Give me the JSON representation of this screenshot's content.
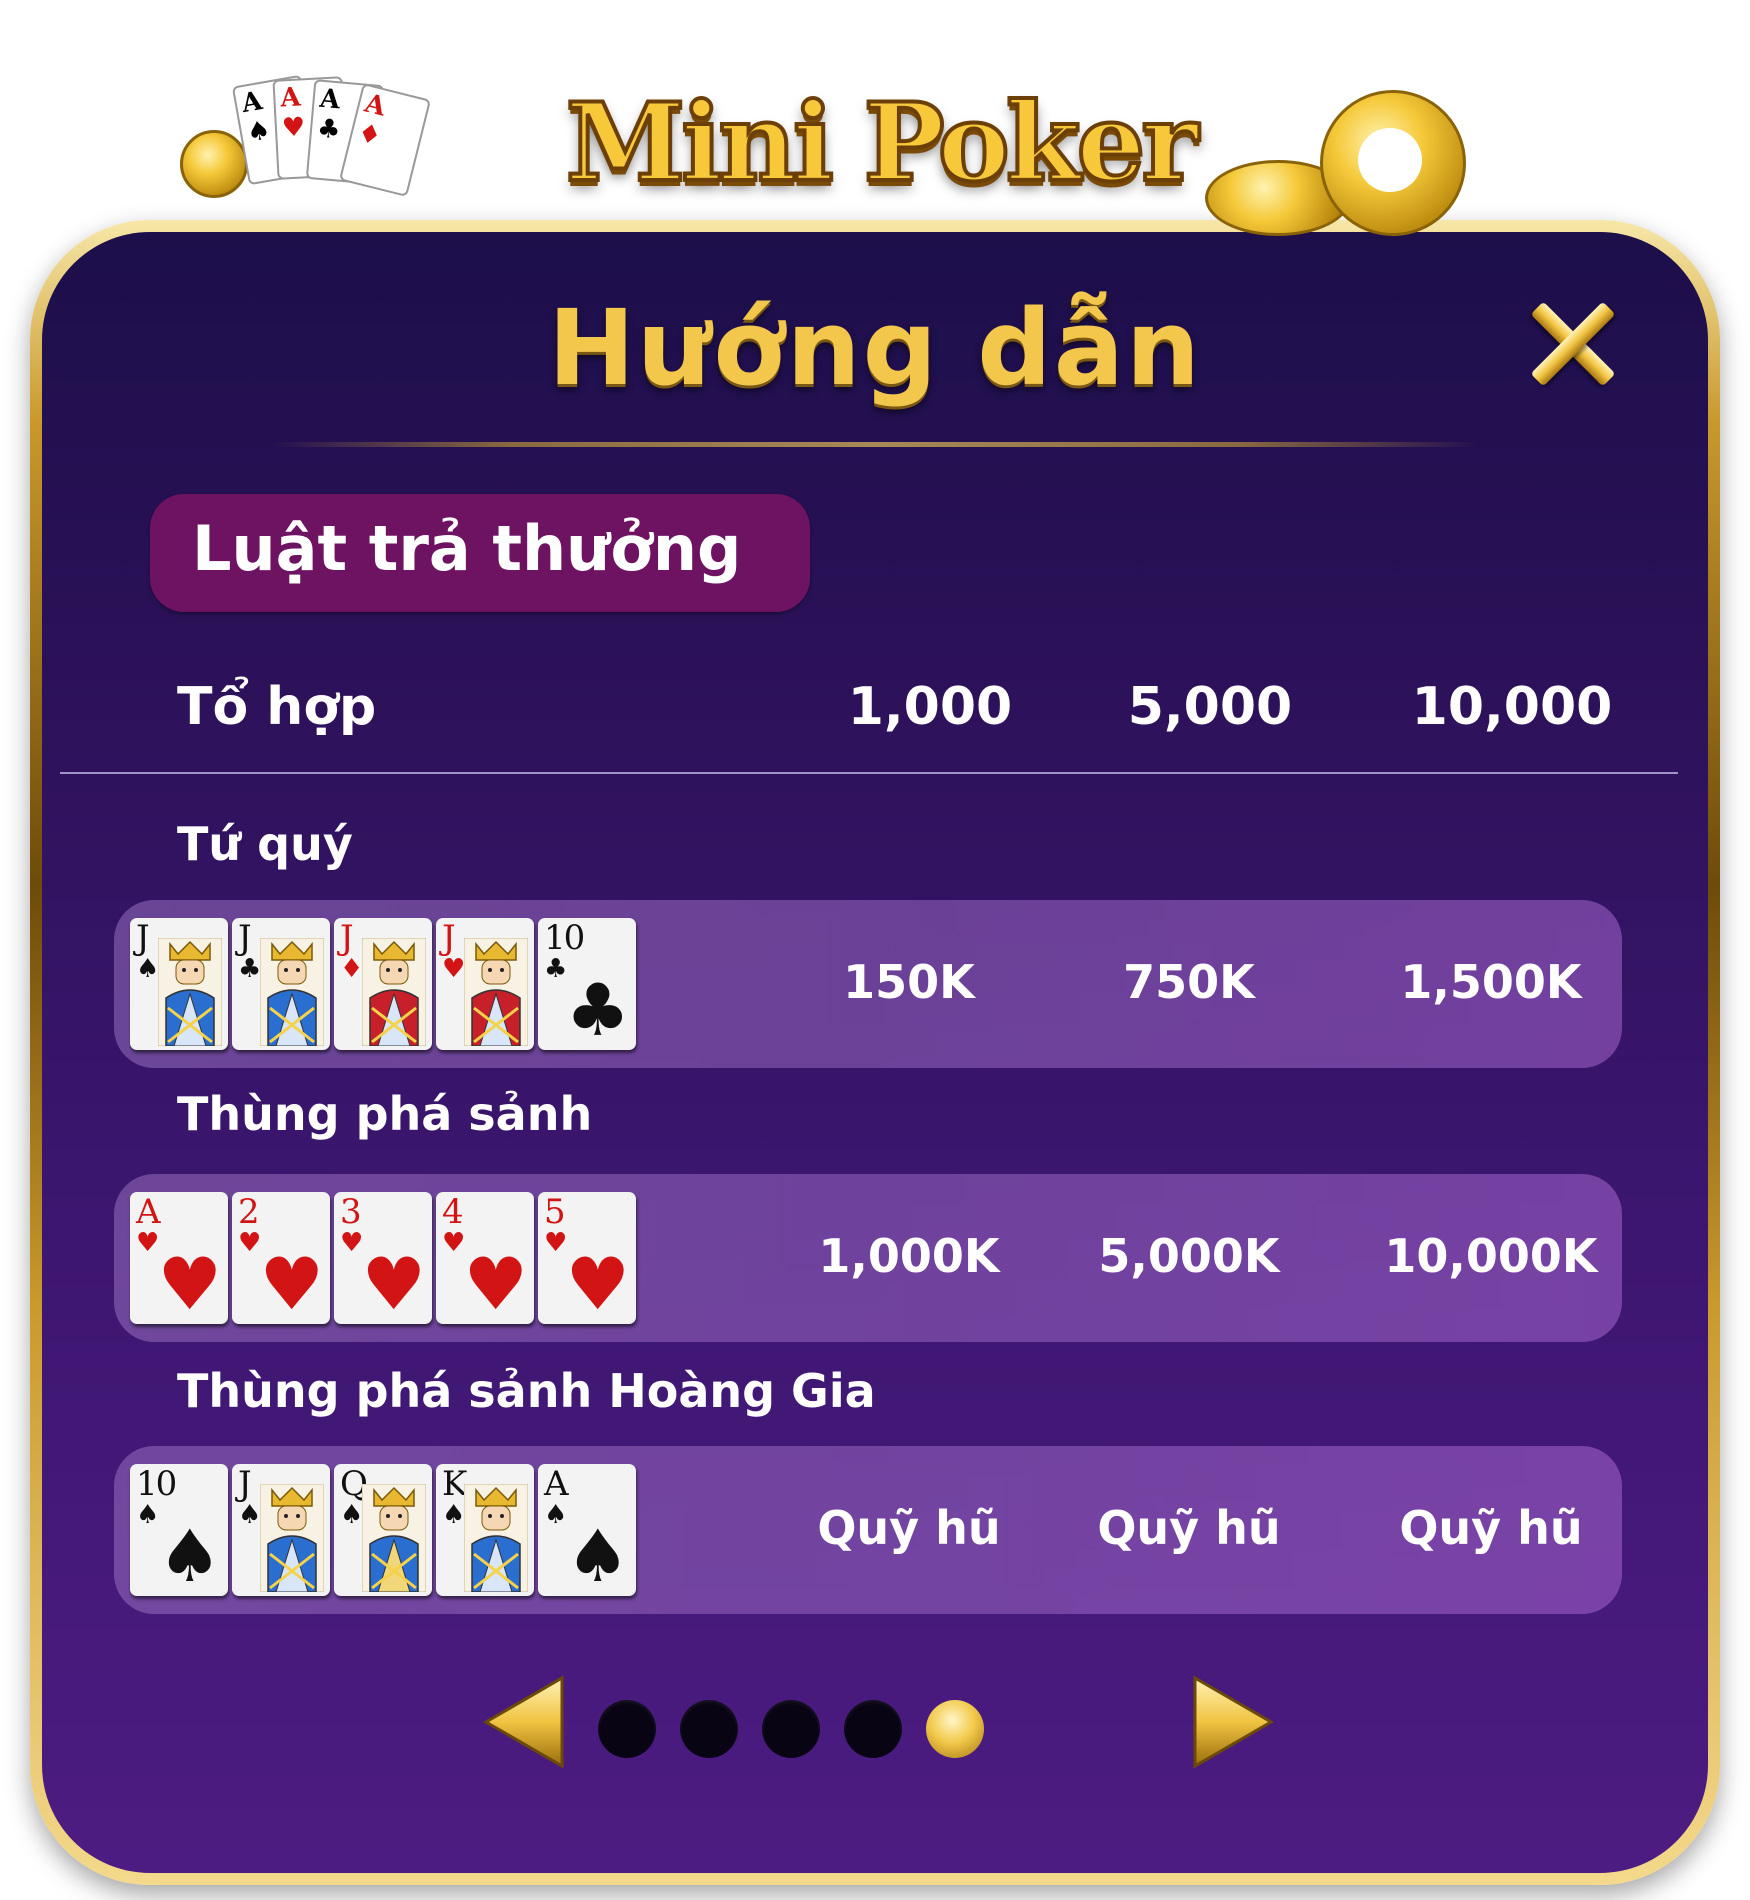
{
  "logo": {
    "text": "Mini Poker",
    "card_rank": "A"
  },
  "dialog": {
    "title": "Hướng dẫn",
    "section_label": "Luật trả thưởng"
  },
  "table": {
    "headers": {
      "combo": "Tổ hợp",
      "bets": [
        "1,000",
        "5,000",
        "10,000"
      ]
    },
    "rows": [
      {
        "name": "Tứ quý",
        "cards": [
          {
            "rank": "J",
            "suit": "♠",
            "color": "black",
            "face": "jack"
          },
          {
            "rank": "J",
            "suit": "♣",
            "color": "black",
            "face": "jack"
          },
          {
            "rank": "J",
            "suit": "♦",
            "color": "red",
            "face": "jack"
          },
          {
            "rank": "J",
            "suit": "♥",
            "color": "red",
            "face": "jack"
          },
          {
            "rank": "10",
            "suit": "♣",
            "color": "black",
            "face": ""
          }
        ],
        "payouts": [
          "150K",
          "750K",
          "1,500K"
        ]
      },
      {
        "name": "Thùng phá sảnh",
        "cards": [
          {
            "rank": "A",
            "suit": "♥",
            "color": "red",
            "face": ""
          },
          {
            "rank": "2",
            "suit": "♥",
            "color": "red",
            "face": ""
          },
          {
            "rank": "3",
            "suit": "♥",
            "color": "red",
            "face": ""
          },
          {
            "rank": "4",
            "suit": "♥",
            "color": "red",
            "face": ""
          },
          {
            "rank": "5",
            "suit": "♥",
            "color": "red",
            "face": ""
          }
        ],
        "payouts": [
          "1,000K",
          "5,000K",
          "10,000K"
        ]
      },
      {
        "name": "Thùng phá sảnh Hoàng Gia",
        "cards": [
          {
            "rank": "10",
            "suit": "♠",
            "color": "black",
            "face": ""
          },
          {
            "rank": "J",
            "suit": "♠",
            "color": "black",
            "face": "jack"
          },
          {
            "rank": "Q",
            "suit": "♠",
            "color": "black",
            "face": "queen"
          },
          {
            "rank": "K",
            "suit": "♠",
            "color": "black",
            "face": "king"
          },
          {
            "rank": "A",
            "suit": "♠",
            "color": "black",
            "face": ""
          }
        ],
        "payouts": [
          "Quỹ hũ",
          "Quỹ hũ",
          "Quỹ hũ"
        ]
      }
    ]
  },
  "pager": {
    "page_count": 5,
    "current_page": 5
  },
  "colors": {
    "gold": "#f3c64c",
    "panel_top": "#1c0f4a",
    "panel_bottom": "#4d1c82",
    "section_label_bg": "#6e1262",
    "card_red": "#d21414"
  }
}
